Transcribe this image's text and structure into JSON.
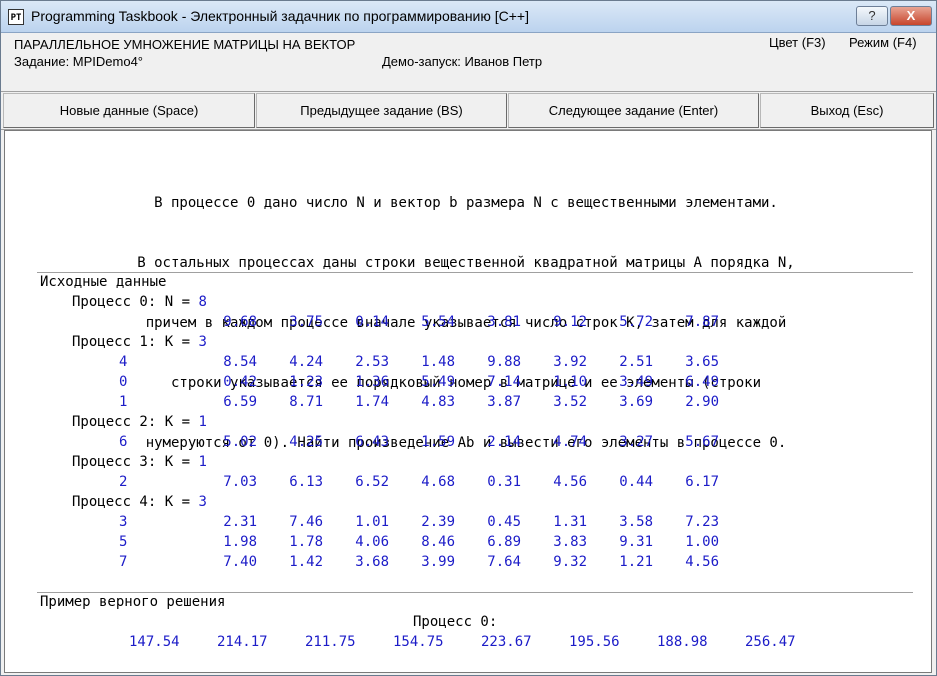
{
  "window": {
    "title": "Programming Taskbook - Электронный задачник по программированию [C++]",
    "icon_text": "PT",
    "help_label": "?",
    "close_label": "X"
  },
  "info": {
    "task_title": "ПАРАЛЛЕЛЬНОЕ УМНОЖЕНИЕ МАТРИЦЫ НА ВЕКТОР",
    "task_name": "Задание: MPIDemo4°",
    "demo_run": "Демо-запуск: Иванов Петр",
    "color_label": "Цвет (F3)",
    "mode_label": "Режим (F4)"
  },
  "toolbar": {
    "new_data": "Новые данные (Space)",
    "prev_task": "Предыдущее задание (BS)",
    "next_task": "Следующее задание (Enter)",
    "exit": "Выход (Esc)"
  },
  "description": [
    "В процессе 0 дано число N и вектор b размера N с вещественными элементами.",
    "В остальных процессах даны строки вещественной квадратной матрицы A порядка N,",
    "причем в каждом процессе вначале указывается число строк K, затем для каждой",
    "строки указывается ее порядковый номер в матрице и ее элементы (строки",
    "нумеруются от 0). Найти произведение Ab и вывести его элементы в процессе 0."
  ],
  "input": {
    "header": "Исходные данные",
    "process0": {
      "label": "Процесс 0: N = ",
      "n": "8",
      "vector": [
        "9.68",
        "3.75",
        "0.14",
        "5.54",
        "3.81",
        "9.12",
        "5.72",
        "7.87"
      ]
    },
    "processes": [
      {
        "label": "Процесс 1: K = ",
        "k": "3",
        "rows": [
          {
            "index": "4",
            "values": [
              "8.54",
              "4.24",
              "2.53",
              "1.48",
              "9.88",
              "3.92",
              "2.51",
              "3.65"
            ]
          },
          {
            "index": "0",
            "values": [
              "0.42",
              "1.23",
              "1.36",
              "5.49",
              "7.14",
              "1.10",
              "3.49",
              "6.49"
            ]
          },
          {
            "index": "1",
            "values": [
              "6.59",
              "8.71",
              "1.74",
              "4.83",
              "3.87",
              "3.52",
              "3.69",
              "2.90"
            ]
          }
        ]
      },
      {
        "label": "Процесс 2: K = ",
        "k": "1",
        "rows": [
          {
            "index": "6",
            "values": [
              "5.02",
              "4.25",
              "6.43",
              "1.59",
              "2.14",
              "4.74",
              "3.27",
              "5.67"
            ]
          }
        ]
      },
      {
        "label": "Процесс 3: K = ",
        "k": "1",
        "rows": [
          {
            "index": "2",
            "values": [
              "7.03",
              "6.13",
              "6.52",
              "4.68",
              "0.31",
              "4.56",
              "0.44",
              "6.17"
            ]
          }
        ]
      },
      {
        "label": "Процесс 4: K = ",
        "k": "3",
        "rows": [
          {
            "index": "3",
            "values": [
              "2.31",
              "7.46",
              "1.01",
              "2.39",
              "0.45",
              "1.31",
              "3.58",
              "7.23"
            ]
          },
          {
            "index": "5",
            "values": [
              "1.98",
              "1.78",
              "4.06",
              "8.46",
              "6.89",
              "3.83",
              "9.31",
              "1.00"
            ]
          },
          {
            "index": "7",
            "values": [
              "7.40",
              "1.42",
              "3.68",
              "3.99",
              "7.64",
              "9.32",
              "1.21",
              "4.56"
            ]
          }
        ]
      }
    ]
  },
  "solution": {
    "header": "Пример верного решения",
    "process_label": "Процесс 0:",
    "values": [
      "147.54",
      "214.17",
      "211.75",
      "154.75",
      "223.67",
      "195.56",
      "188.98",
      "256.47"
    ]
  }
}
